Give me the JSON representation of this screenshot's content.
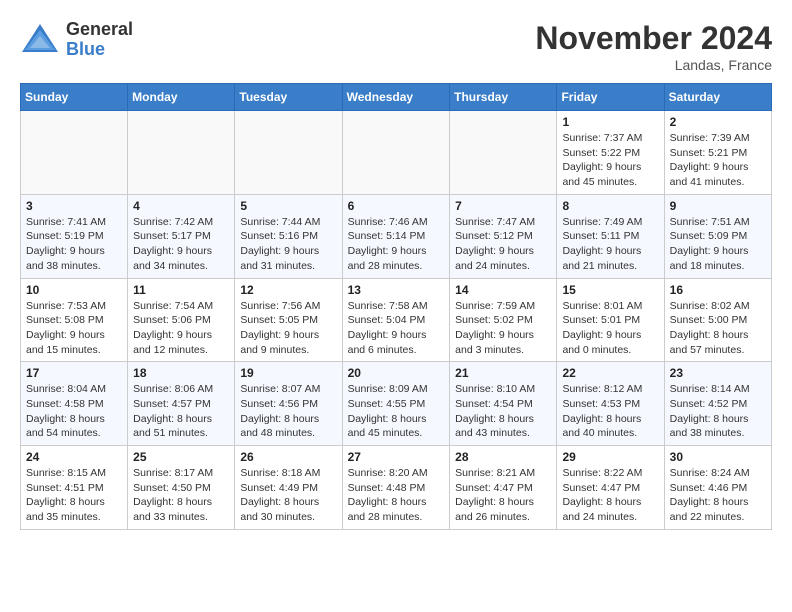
{
  "header": {
    "logo_general": "General",
    "logo_blue": "Blue",
    "month_title": "November 2024",
    "location": "Landas, France"
  },
  "weekdays": [
    "Sunday",
    "Monday",
    "Tuesday",
    "Wednesday",
    "Thursday",
    "Friday",
    "Saturday"
  ],
  "weeks": [
    [
      {
        "day": "",
        "info": ""
      },
      {
        "day": "",
        "info": ""
      },
      {
        "day": "",
        "info": ""
      },
      {
        "day": "",
        "info": ""
      },
      {
        "day": "",
        "info": ""
      },
      {
        "day": "1",
        "info": "Sunrise: 7:37 AM\nSunset: 5:22 PM\nDaylight: 9 hours and 45 minutes."
      },
      {
        "day": "2",
        "info": "Sunrise: 7:39 AM\nSunset: 5:21 PM\nDaylight: 9 hours and 41 minutes."
      }
    ],
    [
      {
        "day": "3",
        "info": "Sunrise: 7:41 AM\nSunset: 5:19 PM\nDaylight: 9 hours and 38 minutes."
      },
      {
        "day": "4",
        "info": "Sunrise: 7:42 AM\nSunset: 5:17 PM\nDaylight: 9 hours and 34 minutes."
      },
      {
        "day": "5",
        "info": "Sunrise: 7:44 AM\nSunset: 5:16 PM\nDaylight: 9 hours and 31 minutes."
      },
      {
        "day": "6",
        "info": "Sunrise: 7:46 AM\nSunset: 5:14 PM\nDaylight: 9 hours and 28 minutes."
      },
      {
        "day": "7",
        "info": "Sunrise: 7:47 AM\nSunset: 5:12 PM\nDaylight: 9 hours and 24 minutes."
      },
      {
        "day": "8",
        "info": "Sunrise: 7:49 AM\nSunset: 5:11 PM\nDaylight: 9 hours and 21 minutes."
      },
      {
        "day": "9",
        "info": "Sunrise: 7:51 AM\nSunset: 5:09 PM\nDaylight: 9 hours and 18 minutes."
      }
    ],
    [
      {
        "day": "10",
        "info": "Sunrise: 7:53 AM\nSunset: 5:08 PM\nDaylight: 9 hours and 15 minutes."
      },
      {
        "day": "11",
        "info": "Sunrise: 7:54 AM\nSunset: 5:06 PM\nDaylight: 9 hours and 12 minutes."
      },
      {
        "day": "12",
        "info": "Sunrise: 7:56 AM\nSunset: 5:05 PM\nDaylight: 9 hours and 9 minutes."
      },
      {
        "day": "13",
        "info": "Sunrise: 7:58 AM\nSunset: 5:04 PM\nDaylight: 9 hours and 6 minutes."
      },
      {
        "day": "14",
        "info": "Sunrise: 7:59 AM\nSunset: 5:02 PM\nDaylight: 9 hours and 3 minutes."
      },
      {
        "day": "15",
        "info": "Sunrise: 8:01 AM\nSunset: 5:01 PM\nDaylight: 9 hours and 0 minutes."
      },
      {
        "day": "16",
        "info": "Sunrise: 8:02 AM\nSunset: 5:00 PM\nDaylight: 8 hours and 57 minutes."
      }
    ],
    [
      {
        "day": "17",
        "info": "Sunrise: 8:04 AM\nSunset: 4:58 PM\nDaylight: 8 hours and 54 minutes."
      },
      {
        "day": "18",
        "info": "Sunrise: 8:06 AM\nSunset: 4:57 PM\nDaylight: 8 hours and 51 minutes."
      },
      {
        "day": "19",
        "info": "Sunrise: 8:07 AM\nSunset: 4:56 PM\nDaylight: 8 hours and 48 minutes."
      },
      {
        "day": "20",
        "info": "Sunrise: 8:09 AM\nSunset: 4:55 PM\nDaylight: 8 hours and 45 minutes."
      },
      {
        "day": "21",
        "info": "Sunrise: 8:10 AM\nSunset: 4:54 PM\nDaylight: 8 hours and 43 minutes."
      },
      {
        "day": "22",
        "info": "Sunrise: 8:12 AM\nSunset: 4:53 PM\nDaylight: 8 hours and 40 minutes."
      },
      {
        "day": "23",
        "info": "Sunrise: 8:14 AM\nSunset: 4:52 PM\nDaylight: 8 hours and 38 minutes."
      }
    ],
    [
      {
        "day": "24",
        "info": "Sunrise: 8:15 AM\nSunset: 4:51 PM\nDaylight: 8 hours and 35 minutes."
      },
      {
        "day": "25",
        "info": "Sunrise: 8:17 AM\nSunset: 4:50 PM\nDaylight: 8 hours and 33 minutes."
      },
      {
        "day": "26",
        "info": "Sunrise: 8:18 AM\nSunset: 4:49 PM\nDaylight: 8 hours and 30 minutes."
      },
      {
        "day": "27",
        "info": "Sunrise: 8:20 AM\nSunset: 4:48 PM\nDaylight: 8 hours and 28 minutes."
      },
      {
        "day": "28",
        "info": "Sunrise: 8:21 AM\nSunset: 4:47 PM\nDaylight: 8 hours and 26 minutes."
      },
      {
        "day": "29",
        "info": "Sunrise: 8:22 AM\nSunset: 4:47 PM\nDaylight: 8 hours and 24 minutes."
      },
      {
        "day": "30",
        "info": "Sunrise: 8:24 AM\nSunset: 4:46 PM\nDaylight: 8 hours and 22 minutes."
      }
    ]
  ]
}
